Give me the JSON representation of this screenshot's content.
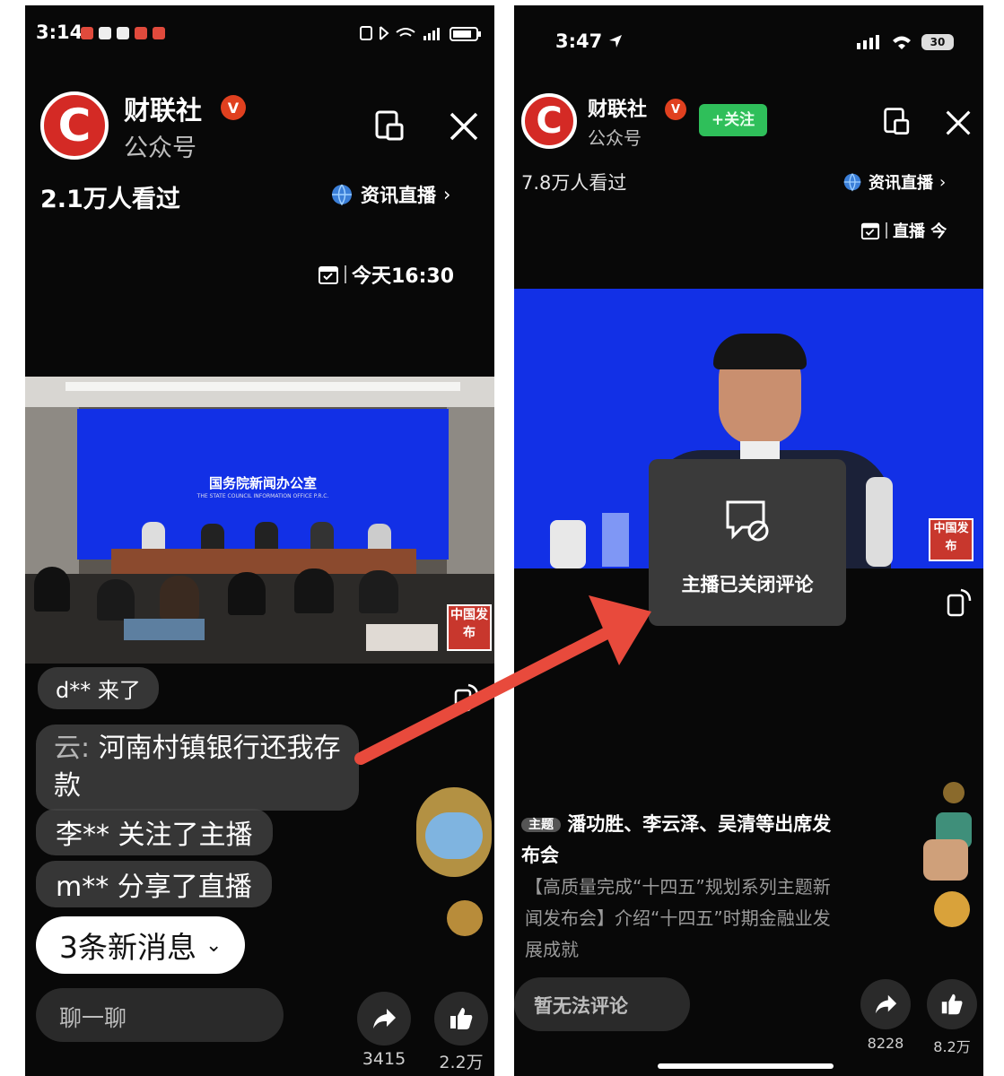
{
  "left": {
    "status_time": "3:14",
    "account_name": "财联社",
    "account_type": "公众号",
    "verified_badge": "V",
    "logo_letter": "C",
    "views": "2.1万人看过",
    "news_live_link": "资讯直播",
    "schedule": "今天16:30",
    "screen_banner_cn": "国务院新闻办公室",
    "screen_banner_en": "THE STATE COUNCIL INFORMATION OFFICE P.R.C.",
    "watermark": "中国发布",
    "chat_messages": [
      {
        "user": "d**",
        "text": "来了"
      },
      {
        "user": "云:",
        "text": "河南村镇银行还我存款"
      },
      {
        "user": "李**",
        "text": "关注了主播"
      },
      {
        "user": "m**",
        "text": "分享了直播"
      }
    ],
    "new_messages": "3条新消息",
    "chat_placeholder": "聊一聊",
    "share_count": "3415",
    "like_count": "2.2万"
  },
  "right": {
    "status_time": "3:47",
    "battery": "30",
    "account_name": "财联社",
    "account_type": "公众号",
    "verified_badge": "V",
    "logo_letter": "C",
    "follow_label": "+关注",
    "views": "7.8万人看过",
    "news_live_link": "资讯直播",
    "schedule": "直播 今",
    "watermark": "中国发布",
    "comments_closed": "主播已关闭评论",
    "topic_tag": "主题",
    "topic_title": "潘功胜、李云泽、吴清等出席发布会",
    "topic_desc": "【高质量完成“十四五”规划系列主题新闻发布会】介绍“十四五”时期金融业发展成就",
    "comment_disabled": "暂无法评论",
    "share_count": "8228",
    "like_count": "8.2万"
  },
  "colors": {
    "accent_red": "#e84a3c",
    "follow_green": "#2fbf5a",
    "stage_blue": "#1230e6",
    "brand_red": "#d42a25"
  },
  "icons": [
    "chevron-right-icon",
    "globe-icon",
    "calendar-icon",
    "mini-window-icon",
    "close-icon",
    "share-icon",
    "like-icon",
    "rotate-icon",
    "comment-off-icon",
    "location-arrow-icon",
    "wifi-icon",
    "signal-icon",
    "battery-icon",
    "chevron-down-icon"
  ]
}
